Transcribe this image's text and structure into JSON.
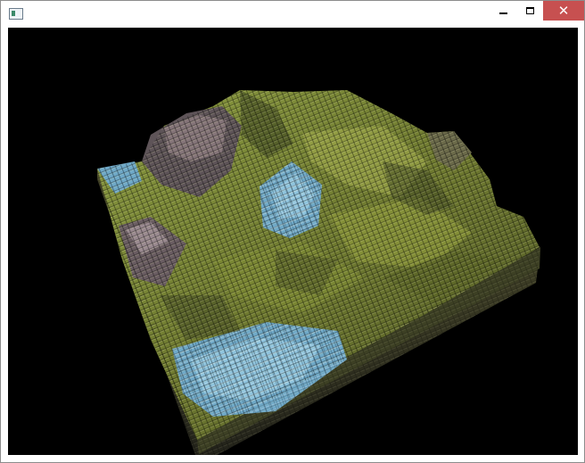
{
  "window": {
    "title": "",
    "controls": {
      "minimize_glyph": "",
      "maximize_glyph": "",
      "close_glyph": "✕"
    },
    "colors": {
      "titlebar": "#ffffff",
      "close_hover": "#c75050",
      "viewport_bg": "#000000"
    }
  },
  "scene": {
    "description_icon": "voxel-terrain",
    "palette": {
      "grass": "#7d8a3a",
      "grass_light": "#a5ad4e",
      "grass_dark": "#3c4420",
      "rock": "#6e6266",
      "rock_light": "#9c8d92",
      "water": "#6fa9c8",
      "water_light": "#8fc4de",
      "side": "#3a3a22"
    }
  }
}
